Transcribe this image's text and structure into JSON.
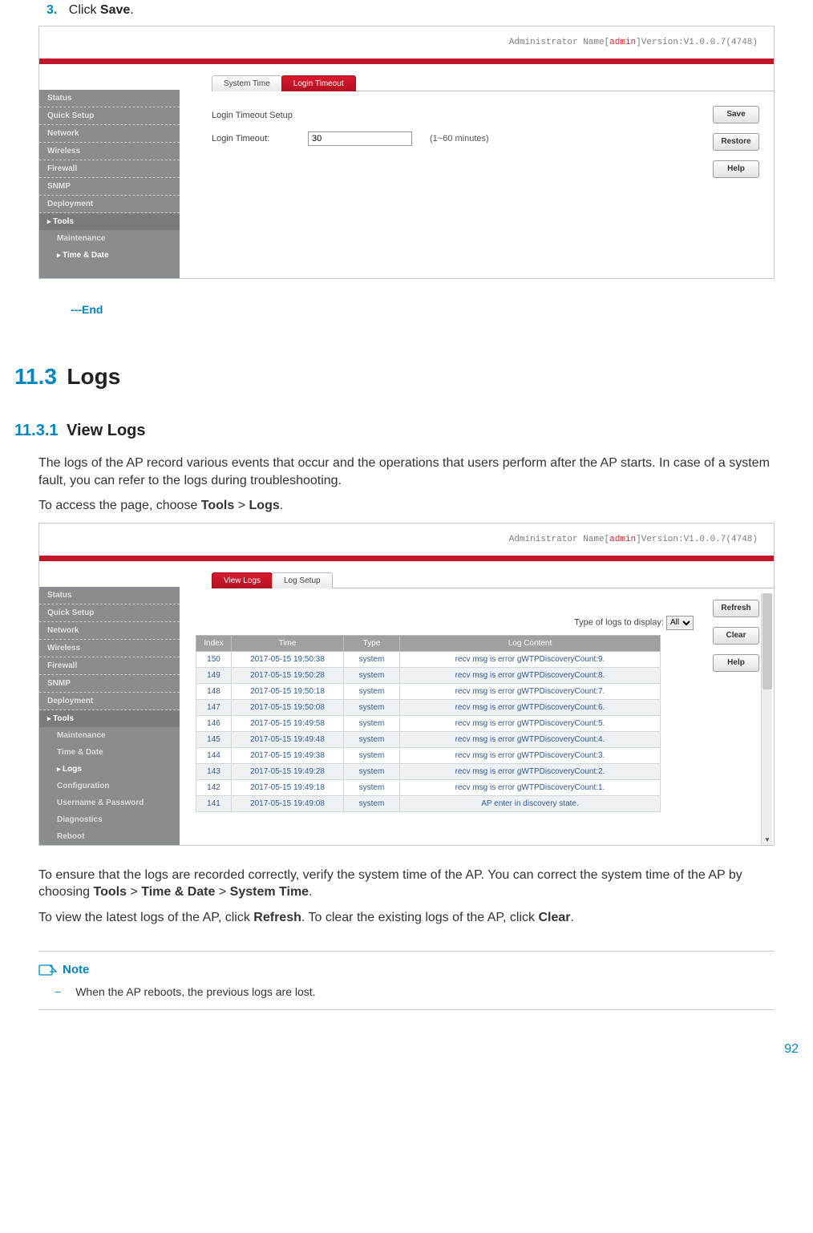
{
  "step3": {
    "num": "3.",
    "text": "Click ",
    "bold": "Save",
    "tail": "."
  },
  "end_mark": "---End",
  "h11_3": {
    "num": "11.3",
    "title": "Logs"
  },
  "h11_3_1": {
    "num": "11.3.1",
    "title": "View Logs"
  },
  "para1": "The logs of the AP record various events that occur and the operations that users perform after the AP starts. In case of a system fault, you can refer to the logs during troubleshooting.",
  "para2_pre": "To access the page, choose ",
  "para2_b1": "Tools",
  "para2_sep": " > ",
  "para2_b2": "Logs",
  "para2_tail": ".",
  "para3_a": "To ensure that the logs are recorded correctly, verify the system time of the AP. You can correct the system time of the AP by choosing ",
  "para3_b1": "Tools",
  "para3_b2": "Time & Date",
  "para3_b3": "System Time",
  "para3_tail": ".",
  "para4_a": "To view the latest logs of the AP, click ",
  "para4_b1": "Refresh",
  "para4_mid": ". To clear the existing logs of the AP, click ",
  "para4_b2": "Clear",
  "para4_tail": ".",
  "note": {
    "head": "Note",
    "item_dash": "−",
    "item_text": "When the AP reboots, the previous logs are lost."
  },
  "page_num": "92",
  "ss_topbar": {
    "prefix": "Administrator Name[",
    "admin": "admin",
    "suffix": "]Version:V1.0.0.7(4748)"
  },
  "ss1": {
    "tabs": {
      "inactive": "System Time",
      "active": "Login Timeout"
    },
    "heading": "Login Timeout Setup",
    "label": "Login Timeout:",
    "value": "30",
    "hint": "(1~60 minutes)",
    "buttons": {
      "save": "Save",
      "restore": "Restore",
      "help": "Help"
    },
    "sidebar": [
      "Status",
      "Quick Setup",
      "Network",
      "Wireless",
      "Firewall",
      "SNMP",
      "Deployment"
    ],
    "sidebar_active": "Tools",
    "sidebar_sub": [
      "Maintenance",
      "Time & Date"
    ],
    "sidebar_sub_selected": "Time & Date"
  },
  "ss2": {
    "tabs": {
      "active": "View Logs",
      "inactive": "Log Setup"
    },
    "filter_label": "Type of logs to display:",
    "filter_value": "All",
    "buttons": {
      "refresh": "Refresh",
      "clear": "Clear",
      "help": "Help"
    },
    "sidebar": [
      "Status",
      "Quick Setup",
      "Network",
      "Wireless",
      "Firewall",
      "SNMP",
      "Deployment"
    ],
    "sidebar_active": "Tools",
    "sidebar_sub": [
      "Maintenance",
      "Time & Date",
      "Logs",
      "Configuration",
      "Username & Password",
      "Diagnostics",
      "Reboot"
    ],
    "sidebar_sub_selected": "Logs",
    "table_headers": {
      "index": "Index",
      "time": "Time",
      "type": "Type",
      "content": "Log Content"
    },
    "rows": [
      {
        "idx": "150",
        "time": "2017-05-15 19:50:38",
        "type": "system",
        "content": "recv msg is error gWTPDiscoveryCount:9."
      },
      {
        "idx": "149",
        "time": "2017-05-15 19:50:28",
        "type": "system",
        "content": "recv msg is error gWTPDiscoveryCount:8."
      },
      {
        "idx": "148",
        "time": "2017-05-15 19:50:18",
        "type": "system",
        "content": "recv msg is error gWTPDiscoveryCount:7."
      },
      {
        "idx": "147",
        "time": "2017-05-15 19:50:08",
        "type": "system",
        "content": "recv msg is error gWTPDiscoveryCount:6."
      },
      {
        "idx": "146",
        "time": "2017-05-15 19:49:58",
        "type": "system",
        "content": "recv msg is error gWTPDiscoveryCount:5."
      },
      {
        "idx": "145",
        "time": "2017-05-15 19:49:48",
        "type": "system",
        "content": "recv msg is error gWTPDiscoveryCount:4."
      },
      {
        "idx": "144",
        "time": "2017-05-15 19:49:38",
        "type": "system",
        "content": "recv msg is error gWTPDiscoveryCount:3."
      },
      {
        "idx": "143",
        "time": "2017-05-15 19:49:28",
        "type": "system",
        "content": "recv msg is error gWTPDiscoveryCount:2."
      },
      {
        "idx": "142",
        "time": "2017-05-15 19:49:18",
        "type": "system",
        "content": "recv msg is error gWTPDiscoveryCount:1."
      },
      {
        "idx": "141",
        "time": "2017-05-15 19:49:08",
        "type": "system",
        "content": "AP enter in discovery state."
      }
    ]
  }
}
